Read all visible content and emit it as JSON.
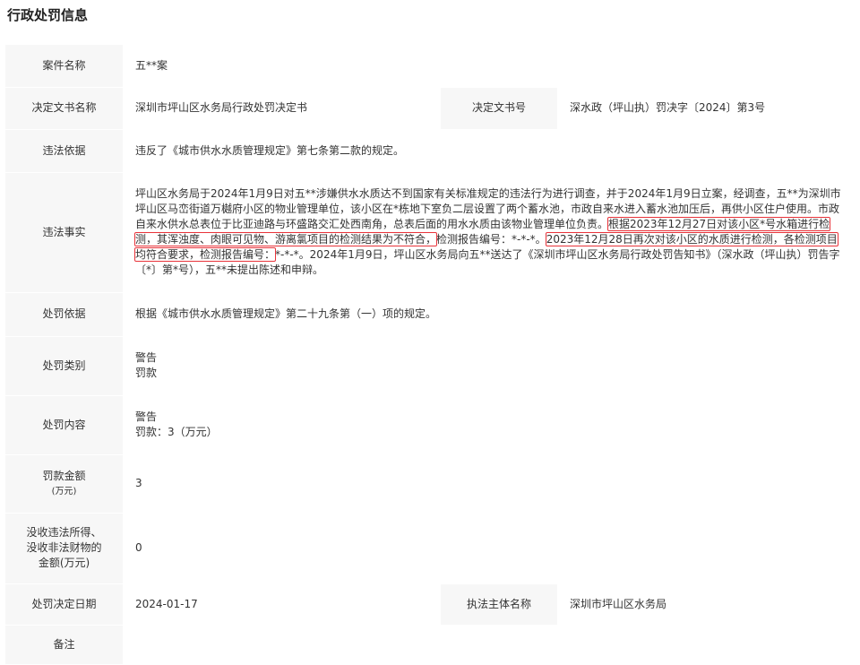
{
  "page_title": "行政处罚信息",
  "rows": {
    "case_name": {
      "label": "案件名称",
      "value": "五**案"
    },
    "decision_doc": {
      "label": "决定文书名称",
      "value": "深圳市坪山区水务局行政处罚决定书",
      "label2": "决定文书号",
      "value2": "深水政（坪山执）罚决字〔2024〕第3号"
    },
    "violation_basis": {
      "label": "违法依据",
      "value": "违反了《城市供水水质管理规定》第七条第二款的规定。"
    },
    "facts": {
      "label": "违法事实",
      "part1": "坪山区水务局于2024年1月9日对五**涉嫌供水水质达不到国家有关标准规定的违法行为进行调查，并于2024年1月9日立案，经调查，五**为深圳市坪山区马峦街道万樾府小区的物业管理单位，该小区在*栋地下室负二层设置了两个蓄水池，市政自来水进入蓄水池加压后，再供小区住户使用。市政自来水供水总表位于比亚迪路与环盛路交汇处西南角，总表后面的用水水质由该物业管理单位负责。",
      "hl1": "根据2023年12月27日对该小区*号水箱进行检测，其浑浊度、肉眼可见物、游离氯项目的检测结果为不符合，",
      "part2": "检测报告编号：*-*-*。",
      "hl2": "2023年12月28日再次对该小区的水质进行检测，各检测项目均符合要求，检测报告编号：",
      "part3": "*-*-*。2024年1月9日，坪山区水务局向五**送达了《深圳市坪山区水务局行政处罚告知书》（深水政（坪山执）罚告字〔*〕第*号），五**未提出陈述和申辩。"
    },
    "penalty_basis": {
      "label": "处罚依据",
      "value": "根据《城市供水水质管理规定》第二十九条第（一）项的规定。"
    },
    "penalty_type": {
      "label": "处罚类别",
      "line1": "警告",
      "line2": "罚款"
    },
    "penalty_content": {
      "label": "处罚内容",
      "line1": "警告",
      "line2": "罚款：3（万元）"
    },
    "fine_amount": {
      "label": "罚款金额",
      "label_unit": "(万元)",
      "value": "3"
    },
    "confiscation": {
      "label_line1": "没收违法所得、",
      "label_line2": "没收非法财物的",
      "label_line3": "金额(万元)",
      "value": "0"
    },
    "decision_date": {
      "label": "处罚决定日期",
      "value": "2024-01-17",
      "label2": "执法主体名称",
      "value2": "深圳市坪山区水务局"
    },
    "remarks": {
      "label": "备注",
      "value": ""
    }
  }
}
